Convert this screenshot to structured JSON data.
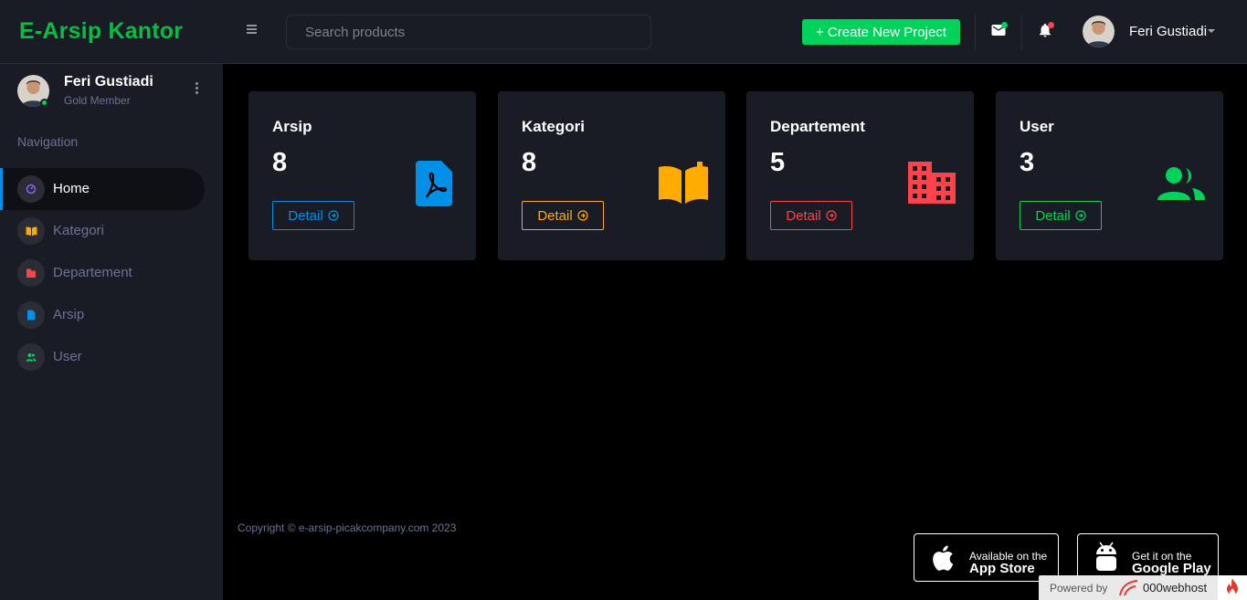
{
  "header": {
    "brand": "E-Arsip Kantor",
    "search_placeholder": "Search products",
    "create_label": "+ Create New Project",
    "user_name": "Feri Gustiadi",
    "mail_dot_color": "#00d25b",
    "bell_dot_color": "#fc424a"
  },
  "sidebar": {
    "profile_name": "Feri Gustiadi",
    "profile_role": "Gold Member",
    "nav_title": "Navigation",
    "items": [
      {
        "label": "Home",
        "icon": "speedometer-icon",
        "color": "#8f5fe8",
        "active": true
      },
      {
        "label": "Kategori",
        "icon": "book-icon",
        "color": "#ffab00"
      },
      {
        "label": "Departement",
        "icon": "office-building-icon",
        "color": "#fc424a"
      },
      {
        "label": "Arsip",
        "icon": "file-icon",
        "color": "#0090e7"
      },
      {
        "label": "User",
        "icon": "account-group-icon",
        "color": "#00d25b"
      }
    ]
  },
  "cards": [
    {
      "title": "Arsip",
      "value": "8",
      "button": "Detail",
      "color": "#0090e7",
      "icon": "pdf-icon"
    },
    {
      "title": "Kategori",
      "value": "8",
      "button": "Detail",
      "color": "#ffab00",
      "icon": "book-open-icon"
    },
    {
      "title": "Departement",
      "value": "5",
      "button": "Detail",
      "color": "#fc424a",
      "icon": "office-building-icon"
    },
    {
      "title": "User",
      "value": "3",
      "button": "Detail",
      "color": "#00d25b",
      "icon": "account-group-icon"
    }
  ],
  "footer": {
    "copyright": "Copyright © e-arsip-picakcompany.com 2023",
    "appstore_small": "Available on the",
    "appstore_big": "App Store",
    "googleplay_small": "Get it on the",
    "googleplay_big": "Google Play",
    "powered_label": "Powered by",
    "powered_brand": "000webhost"
  }
}
